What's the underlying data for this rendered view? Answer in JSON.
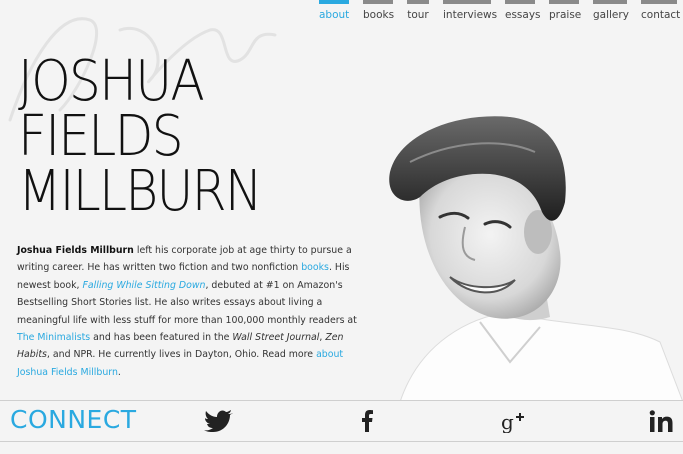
{
  "nav": {
    "items": [
      {
        "label": "about",
        "active": true
      },
      {
        "label": "books",
        "active": false
      },
      {
        "label": "tour",
        "active": false
      },
      {
        "label": "interviews",
        "active": false
      },
      {
        "label": "essays",
        "active": false
      },
      {
        "label": "praise",
        "active": false
      },
      {
        "label": "gallery",
        "active": false
      },
      {
        "label": "contact",
        "active": false
      }
    ],
    "active_color": "#2aa9e0",
    "bar_color": "#8a8a8a"
  },
  "header": {
    "title_lines": [
      "JOSHUA",
      "FIELDS",
      "MILLBURN"
    ]
  },
  "bio": {
    "name": "Joshua Fields Millburn",
    "t1": " left his corporate job at age thirty to pursue a writing career. He has written two fiction and two nonfiction ",
    "books_link": "books",
    "t2": ". His newest book, ",
    "book_title_link": "Falling While Sitting Down",
    "t3": ", debuted at #1 on Amazon's Bestselling Short Stories list. He also writes essays about living a meaningful life with less stuff for more than 100,000 monthly readers at ",
    "minimalists_link": "The Minimalists",
    "t4": " and has been featured in the ",
    "wsj": "Wall Street Journal",
    "t5": ", ",
    "zen": "Zen Habits",
    "t6": ", and NPR. He currently lives in Dayton, Ohio. Read more ",
    "about_link": "about Joshua Fields Millburn",
    "t7": "."
  },
  "connect": {
    "label": "CONNECT",
    "social": [
      {
        "icon": "twitter-icon"
      },
      {
        "icon": "facebook-icon"
      },
      {
        "icon": "google-plus-icon"
      },
      {
        "icon": "linkedin-icon"
      }
    ]
  },
  "colors": {
    "accent": "#2aa9e0",
    "text": "#111111",
    "background": "#f4f4f4"
  }
}
